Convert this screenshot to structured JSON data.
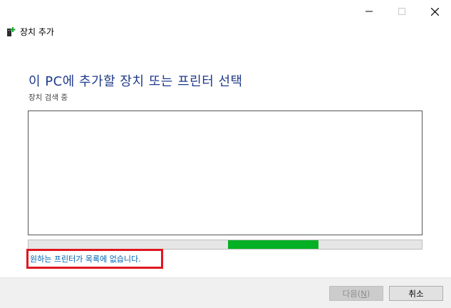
{
  "window": {
    "title": "장치 추가",
    "controls": {
      "minimize_icon": "minimize-icon",
      "maximize_icon": "maximize-icon",
      "close_icon": "close-icon"
    }
  },
  "main": {
    "heading": "이 PC에 추가할 장치 또는 프린터 선택",
    "status": "장치 검색 중",
    "device_list": {
      "items": []
    },
    "progress": {
      "indeterminate": true,
      "fill_color": "#06b025"
    },
    "missing_printer_link": "원하는 프린터가 목록에 없습니다."
  },
  "footer": {
    "next_prefix": "다음(",
    "next_accel": "N",
    "next_suffix": ")",
    "cancel_label": "취소"
  },
  "colors": {
    "heading": "#1f3a8a",
    "link": "#0063b1",
    "highlight_box": "#e0161e"
  }
}
